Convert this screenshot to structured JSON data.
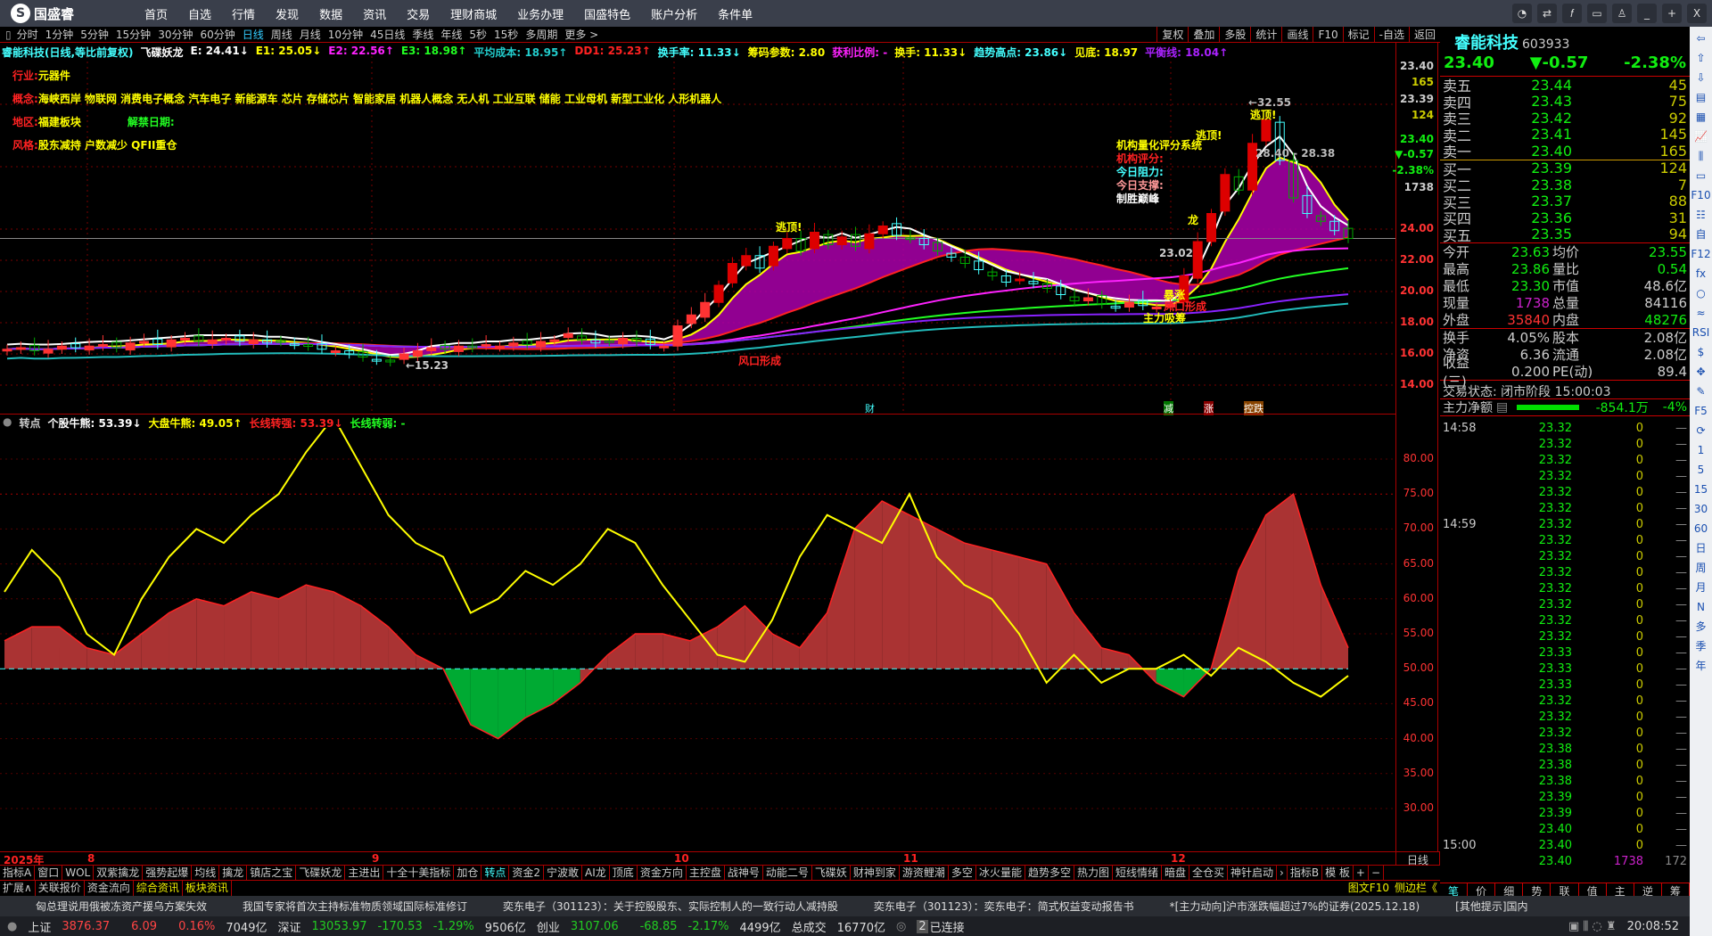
{
  "app": {
    "name": "国盛睿",
    "nav": [
      "首页",
      "自选",
      "行情",
      "发现",
      "数据",
      "资讯",
      "交易",
      "理财商城",
      "业务办理",
      "国盛特色",
      "账户分析",
      "条件单"
    ],
    "window_buttons": [
      "chat-icon",
      "swap-icon",
      "fx-icon",
      "monitor-icon",
      "shirt-icon",
      "minimize-icon",
      "maximize-icon",
      "close-icon"
    ]
  },
  "periods": [
    "分时",
    "1分钟",
    "5分钟",
    "15分钟",
    "30分钟",
    "60分钟",
    "日线",
    "周线",
    "月线",
    "10分钟",
    "45日线",
    "季线",
    "年线",
    "5秒",
    "15秒",
    "多周期",
    "更多 >"
  ],
  "active_period": "日线",
  "chart_tools": [
    "复权",
    "叠加",
    "多股",
    "统计",
    "画线",
    "F10",
    "标记",
    "-自选",
    "返回"
  ],
  "info": [
    {
      "t": "睿能科技(日线,等比前复权)",
      "c": "#4ff"
    },
    {
      "t": "飞碟妖龙",
      "c": "#fff"
    },
    {
      "t": "E: 24.41↓",
      "c": "#fff"
    },
    {
      "t": "E1: 25.05↓",
      "c": "#ff0"
    },
    {
      "t": "E2: 22.56↑",
      "c": "#f2f"
    },
    {
      "t": "E3: 18.98↑",
      "c": "#2f2"
    },
    {
      "t": "平均成本: 18.95↑",
      "c": "#2cc"
    },
    {
      "t": "DD1: 25.23↑",
      "c": "#f22"
    },
    {
      "t": "换手率: 11.33↓",
      "c": "#4ff"
    },
    {
      "t": "筹码参数: 2.80",
      "c": "#ff0"
    },
    {
      "t": "获利比例: -",
      "c": "#f2f"
    },
    {
      "t": "换手: 11.33↓",
      "c": "#ff0"
    },
    {
      "t": "趋势高点: 23.86↓",
      "c": "#4ff"
    },
    {
      "t": "见底: 18.97",
      "c": "#ff0"
    },
    {
      "t": "平衡线: 18.04↑",
      "c": "#a2f"
    }
  ],
  "tags": {
    "industry_k": "行业:",
    "industry_v": "元器件",
    "concept_k": "概念:",
    "concept_v": "海峡西岸 物联网 消费电子概念 汽车电子 新能源车 芯片 存储芯片 智能家居 机器人概念 无人机 工业互联 储能 工业母机 新型工业化 人形机器人",
    "region_k": "地区:",
    "region_v": "福建板块",
    "unlock_k": "解禁日期:",
    "style_k": "风格:",
    "style_v": "股东减持 户数减少 QFII重仓"
  },
  "annotations": {
    "peak": "←32.55",
    "escape1": "逃顶!",
    "escape2": "逃顶!",
    "escape3": "逃顶!",
    "range": "28.40 - 28.38",
    "score_title": "机构量化评分系统",
    "score": "机构评分:",
    "resist": "今日阻力:",
    "support": "今日支撑:",
    "peak_win": "制胜巅峰",
    "low": "←15.23",
    "p2302": "23.02",
    "surge": "暴涨",
    "wind": "风口形成",
    "wind2": "风口形成",
    "absorb": "主力吸筹",
    "dragon": "龙",
    "m_cai": "财",
    "m_jian": "减",
    "m_zhang": "涨",
    "m_kongdie": "控跌"
  },
  "price_axis_top": [
    {
      "t": "23.40",
      "c": "#ccc"
    },
    {
      "t": "165",
      "c": "#cc0"
    },
    {
      "t": "23.39",
      "c": "#ccc"
    },
    {
      "t": "124",
      "c": "#cc0"
    },
    {
      "t": "23.40",
      "c": "#1e1"
    },
    {
      "t": "▼-0.57",
      "c": "#1e1"
    },
    {
      "t": "-2.38%",
      "c": "#1e1"
    },
    {
      "t": "1738",
      "c": "#ccc"
    }
  ],
  "price_axis": [
    "24.00",
    "22.00",
    "20.00",
    "18.00",
    "16.00",
    "14.00"
  ],
  "sub_header": {
    "name": "转点",
    "a": "个股牛熊: 53.39↓",
    "b": "大盘牛熊: 49.05↑",
    "c": "长线转强: 53.39↓",
    "d": "长线转弱: -"
  },
  "sub_axis": [
    "80.00",
    "75.00",
    "70.00",
    "65.00",
    "60.00",
    "55.00",
    "50.00",
    "45.00",
    "40.00",
    "35.00",
    "30.00"
  ],
  "dates": [
    "2025年",
    "8",
    "9",
    "10",
    "11",
    "12"
  ],
  "period_label": "日线",
  "chart_data": {
    "type": "candlestick",
    "closes": [
      16.3,
      16.4,
      16.2,
      16.3,
      16.5,
      16.4,
      16.5,
      16.6,
      16.4,
      16.7,
      16.8,
      16.6,
      16.9,
      17.0,
      16.8,
      16.9,
      17.0,
      16.8,
      16.9,
      16.7,
      16.8,
      16.6,
      16.5,
      16.3,
      16.2,
      16.0,
      15.8,
      15.6,
      15.5,
      16.0,
      16.2,
      16.4,
      16.3,
      16.5,
      16.4,
      16.6,
      16.5,
      16.7,
      16.6,
      16.8,
      16.9,
      17.3,
      16.9,
      16.7,
      16.8,
      17.0,
      16.8,
      16.6,
      16.5,
      17.8,
      18.5,
      19.3,
      20.4,
      21.8,
      22.3,
      21.5,
      22.9,
      23.4,
      22.6,
      23.8,
      23.0,
      23.5,
      22.9,
      23.7,
      24.2,
      23.6,
      23.4,
      23.0,
      22.6,
      22.2,
      21.8,
      21.4,
      21.0,
      20.6,
      20.8,
      20.5,
      20.2,
      19.8,
      19.4,
      19.6,
      19.2,
      19.0,
      19.3,
      19.1,
      19.0,
      19.2,
      21.0,
      23.2,
      25.0,
      27.5,
      26.5,
      29.5,
      31.0,
      28.4,
      26.0,
      25.0,
      24.5,
      23.9,
      23.4
    ],
    "ylim": [
      13,
      33
    ],
    "sub": {
      "ylim": [
        25,
        88
      ],
      "yellow": [
        61,
        67,
        63,
        55,
        52,
        60,
        66,
        70,
        68,
        72,
        75,
        81,
        86,
        79,
        72,
        68,
        66,
        58,
        60,
        64,
        62,
        65,
        70,
        68,
        62,
        57,
        52,
        51,
        57,
        66,
        72,
        70,
        68,
        75,
        66,
        62,
        60,
        55,
        48,
        52,
        48,
        50,
        50,
        52,
        49,
        53,
        51,
        48,
        46,
        49
      ],
      "area": [
        54,
        56,
        56,
        53,
        52,
        55,
        58,
        60,
        59,
        61,
        60,
        62,
        61,
        59,
        56,
        52,
        50,
        42,
        40,
        43,
        45,
        48,
        52,
        55,
        55,
        54,
        56,
        59,
        55,
        53,
        58,
        70,
        74,
        72,
        70,
        68,
        67,
        66,
        65,
        58,
        53,
        52,
        48,
        46,
        50,
        64,
        72,
        75,
        62,
        53
      ]
    }
  },
  "quote": {
    "name": "睿能科技",
    "code": "603933",
    "price": "23.40",
    "change": "▼-0.57",
    "pct": "-2.38%",
    "asks": [
      [
        "卖五",
        "23.44",
        "45"
      ],
      [
        "卖四",
        "23.43",
        "75"
      ],
      [
        "卖三",
        "23.42",
        "92"
      ],
      [
        "卖二",
        "23.41",
        "145"
      ],
      [
        "卖一",
        "23.40",
        "165"
      ]
    ],
    "bids": [
      [
        "买一",
        "23.39",
        "124"
      ],
      [
        "买二",
        "23.38",
        "7"
      ],
      [
        "买三",
        "23.37",
        "88"
      ],
      [
        "买四",
        "23.36",
        "31"
      ],
      [
        "买五",
        "23.35",
        "94"
      ]
    ],
    "stats": [
      [
        "今开",
        "23.63",
        "均价",
        "23.55"
      ],
      [
        "最高",
        "23.86",
        "量比",
        "0.54"
      ],
      [
        "最低",
        "23.30",
        "市值",
        "48.6亿"
      ],
      [
        "现量",
        "1738",
        "总量",
        "84116"
      ],
      [
        "外盘",
        "35840",
        "内盘",
        "48276"
      ]
    ],
    "stats2": [
      [
        "换手",
        "4.05%",
        "股本",
        "2.08亿"
      ],
      [
        "净资",
        "6.36",
        "流通",
        "2.08亿"
      ],
      [
        "收益(三)",
        "0.200",
        "PE(动)",
        "89.4"
      ]
    ],
    "trade_status": "交易状态: 闭市阶段 15:00:03",
    "main_flow_label": "主力净额",
    "main_flow": "-854.1万",
    "main_flow_pct": "-4%"
  },
  "ticks": [
    [
      "14:58",
      "23.32",
      "0",
      "—"
    ],
    [
      "",
      "23.32",
      "0",
      "—"
    ],
    [
      "",
      "23.32",
      "0",
      "—"
    ],
    [
      "",
      "23.32",
      "0",
      "—"
    ],
    [
      "",
      "23.32",
      "0",
      "—"
    ],
    [
      "",
      "23.32",
      "0",
      "—"
    ],
    [
      "14:59",
      "23.32",
      "0",
      "—"
    ],
    [
      "",
      "23.32",
      "0",
      "—"
    ],
    [
      "",
      "23.32",
      "0",
      "—"
    ],
    [
      "",
      "23.32",
      "0",
      "—"
    ],
    [
      "",
      "23.32",
      "0",
      "—"
    ],
    [
      "",
      "23.32",
      "0",
      "—"
    ],
    [
      "",
      "23.32",
      "0",
      "—"
    ],
    [
      "",
      "23.32",
      "0",
      "—"
    ],
    [
      "",
      "23.33",
      "0",
      "—"
    ],
    [
      "",
      "23.33",
      "0",
      "—"
    ],
    [
      "",
      "23.33",
      "0",
      "—"
    ],
    [
      "",
      "23.32",
      "0",
      "—"
    ],
    [
      "",
      "23.32",
      "0",
      "—"
    ],
    [
      "",
      "23.32",
      "0",
      "—"
    ],
    [
      "",
      "23.38",
      "0",
      "—"
    ],
    [
      "",
      "23.38",
      "0",
      "—"
    ],
    [
      "",
      "23.38",
      "0",
      "—"
    ],
    [
      "",
      "23.39",
      "0",
      "—"
    ],
    [
      "",
      "23.39",
      "0",
      "—"
    ],
    [
      "",
      "23.40",
      "0",
      "—"
    ],
    [
      "15:00",
      "23.40",
      "0",
      "—"
    ],
    [
      "",
      "23.40",
      "1738",
      "172"
    ]
  ],
  "right_tabs": [
    "笔",
    "价",
    "细",
    "势",
    "联",
    "值",
    "主",
    "逆",
    "筹"
  ],
  "sidebar": [
    "⇦",
    "⇧",
    "⇩",
    "▤",
    "▦",
    "📈",
    "⫼",
    "▭",
    "F10",
    "☷",
    "自",
    "F12",
    "fx",
    "○",
    "≈",
    "RSI",
    "$",
    "✥",
    "✎",
    "F5",
    "⟳",
    "1",
    "5",
    "15",
    "30",
    "60",
    "日",
    "周",
    "月",
    "N",
    "多",
    "季",
    "年"
  ],
  "indicator_tabs": [
    "指标A",
    "窗口",
    "WOL",
    "双紫擒龙",
    "强势起爆",
    "均线",
    "擒龙",
    "镇店之宝",
    "飞碟妖龙",
    "主进出",
    "十全十美指标",
    "加仓",
    "转点",
    "资金2",
    "宁波敢",
    "AI龙",
    "顶底",
    "资金方向",
    "主控盘",
    "战神号",
    "动能二号",
    "飞碟妖",
    "财神到家",
    "游资鲤潮",
    "多空",
    "冰火量能",
    "趋势多空",
    "热力图",
    "短线情绪",
    "暗盘",
    "全仓买",
    "神针启动",
    "›",
    "指标B",
    "模 板",
    "+",
    "−"
  ],
  "active_indicator": "转点",
  "ext_tabs": [
    "扩展∧",
    "关联报价",
    "资金流向",
    "综合资讯",
    "板块资讯"
  ],
  "ext_right": [
    "图文F10",
    "侧边栏《"
  ],
  "news": [
    "匈总理说用俄被冻资产援乌方案失效",
    "我国专家将首次主持标准物质领域国际标准修订",
    "奕东电子（301123）：关于控股股东、实际控制人的一致行动人减持股",
    "奕东电子（301123）：奕东电子：简式权益变动报告书",
    "*[主力动向]沪市涨跌幅超过7%的证券(2025.12.18)",
    "[其他提示]国内"
  ],
  "status": {
    "sh": "上证",
    "sh_v": "3876.37",
    "sh_c": "6.09",
    "sh_p": "0.16%",
    "sh_a": "7049亿",
    "sz": "深证",
    "sz_v": "13053.97",
    "sz_c": "-170.53",
    "sz_p": "-1.29%",
    "sz_a": "9506亿",
    "cy": "创业",
    "cy_v": "3107.06",
    "cy_c": "-68.85",
    "cy_p": "-2.17%",
    "cy_a": "4499亿",
    "total": "总成交",
    "total_v": "16770亿",
    "conn_n": "2",
    "conn": "已连接",
    "time": "20:08:52"
  }
}
